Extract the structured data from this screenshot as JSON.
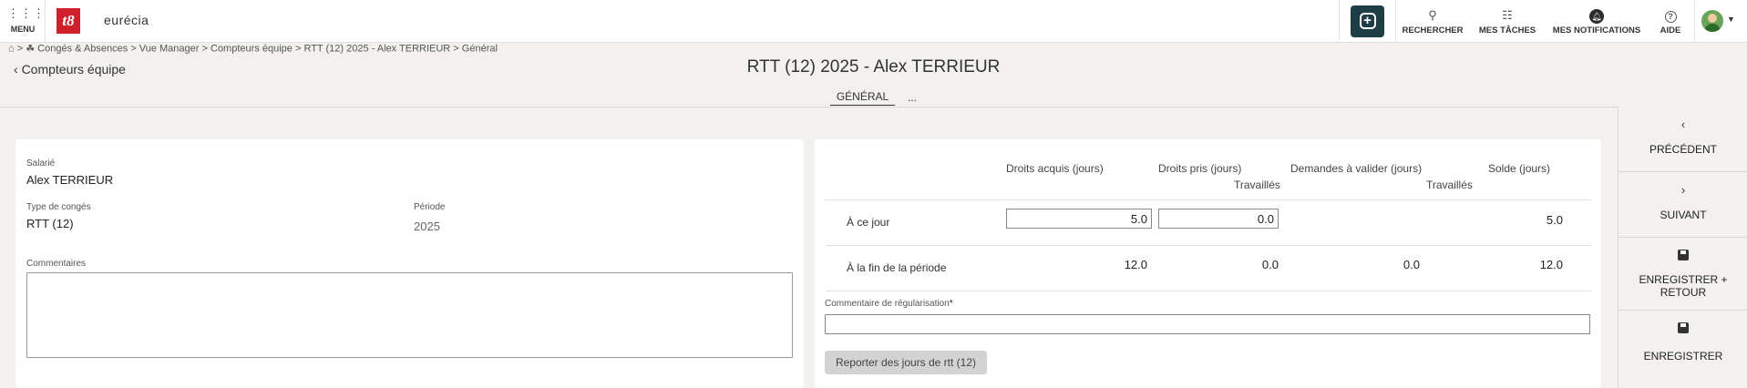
{
  "topbar": {
    "menu_label": "MENU",
    "logo_text": "t8",
    "brand": "eurécia",
    "nav": [
      {
        "id": "search",
        "label": "RECHERCHER"
      },
      {
        "id": "tasks",
        "label": "MES TÂCHES"
      },
      {
        "id": "notifications",
        "label": "MES NOTIFICATIONS"
      },
      {
        "id": "help",
        "label": "AIDE"
      }
    ],
    "icons": {
      "menu": "grid-dots-icon",
      "add": "plus-square-icon",
      "search": "search-icon",
      "tasks": "checklist-icon",
      "notifications": "bell-icon",
      "help": "question-icon",
      "user": "avatar-icon"
    },
    "accent": "#1e3d45",
    "logo_color": "#d0202c"
  },
  "breadcrumb": {
    "sep": ">",
    "items": [
      "Congés & Absences",
      "Vue Manager",
      "Compteurs équipe",
      "RTT (12) 2025 - Alex TERRIEUR",
      "Général"
    ]
  },
  "header": {
    "back_label": "Compteurs équipe",
    "title": "RTT (12) 2025 - Alex TERRIEUR",
    "tabs": [
      {
        "label": "GÉNÉRAL",
        "active": true
      },
      {
        "label": "..."
      }
    ]
  },
  "form": {
    "employee_label": "Salarié",
    "employee_value": "Alex TERRIEUR",
    "leave_type_label": "Type de congés",
    "leave_type_value": "RTT (12)",
    "period_label": "Période",
    "period_value": "2025",
    "comments_label": "Commentaires",
    "comments_value": ""
  },
  "counters": {
    "headers": {
      "acquired": "Droits acquis (jours)",
      "taken": "Droits pris (jours)",
      "taken_sub": "Travaillés",
      "pending": "Demandes à valider (jours)",
      "pending_sub": "Travaillés",
      "balance": "Solde (jours)"
    },
    "rows": [
      {
        "label": "À ce jour",
        "acquired": "5.0",
        "taken": "0.0",
        "pending": "",
        "balance": "5.0"
      },
      {
        "label": "À la fin de la période",
        "acquired": "12.0",
        "taken": "0.0",
        "pending": "0.0",
        "balance": "12.0"
      }
    ],
    "regularisation_label": "Commentaire de régularisation",
    "regularisation_required": "*",
    "regularisation_value": "",
    "report_button": "Reporter des jours de rtt (12)"
  },
  "actions": [
    {
      "id": "previous",
      "label": "PRÉCÉDENT"
    },
    {
      "id": "next",
      "label": "SUIVANT"
    },
    {
      "id": "save_return",
      "label": "ENREGISTRER + RETOUR"
    },
    {
      "id": "save",
      "label": "ENREGISTRER"
    }
  ]
}
